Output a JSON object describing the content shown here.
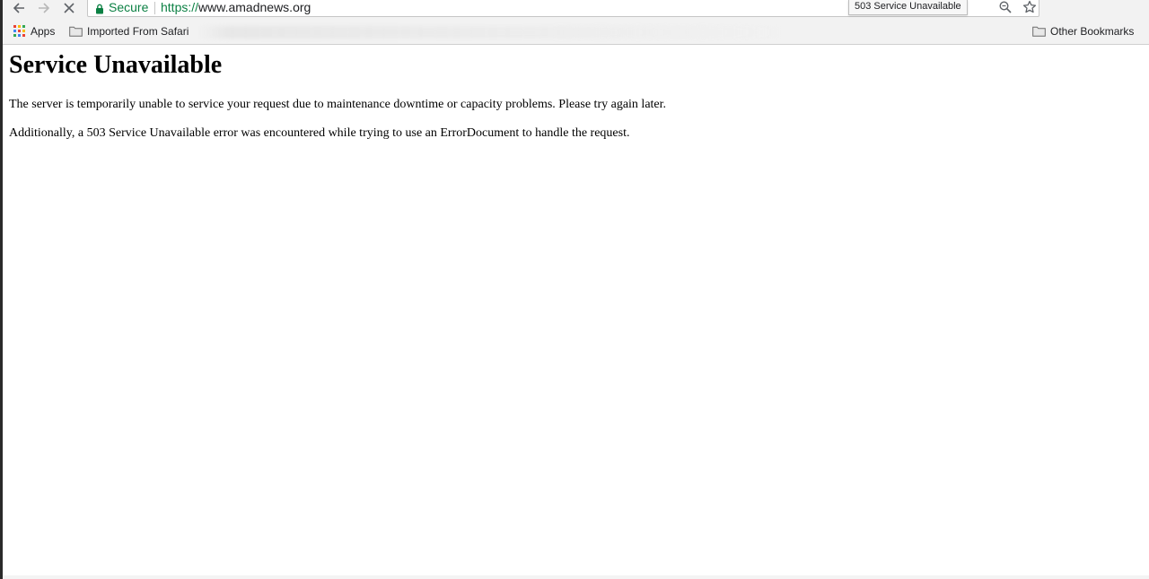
{
  "browser": {
    "omnibox": {
      "secure_label": "Secure",
      "url_scheme": "https://",
      "url_host": "www.amadnews.org"
    },
    "tooltip": "503 Service Unavailable",
    "bookmarks": {
      "apps_label": "Apps",
      "imported_label": "Imported From Safari",
      "other_label": "Other Bookmarks"
    }
  },
  "page": {
    "heading": "Service Unavailable",
    "paragraph_1": "The server is temporarily unable to service your request due to maintenance downtime or capacity problems. Please try again later.",
    "paragraph_2": "Additionally, a 503 Service Unavailable error was encountered while trying to use an ErrorDocument to handle the request."
  },
  "colors": {
    "secure_green": "#0b8043",
    "chrome_bg": "#f2f2f2",
    "page_bg": "#ffffff"
  }
}
